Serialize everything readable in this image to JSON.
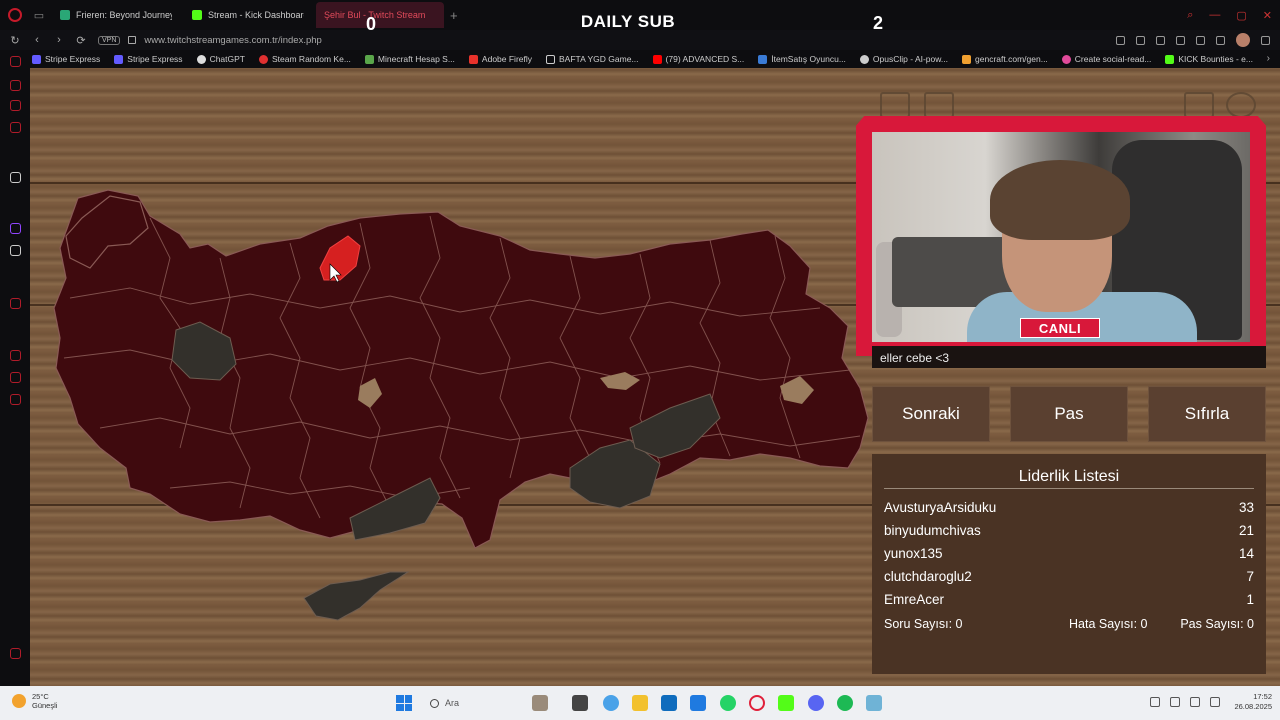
{
  "browser": {
    "tabs": [
      {
        "label": "Frieren: Beyond Journey's",
        "color": "#2aa776",
        "active": false
      },
      {
        "label": "Stream - Kick Dashboard",
        "color": "#53fc18",
        "active": false
      },
      {
        "label": "Şehir Bul - Twitch Stream",
        "color": "#c9405a",
        "active": true
      }
    ],
    "vpn": "VPN",
    "url": "www.twitchstreamgames.com.tr/index.php",
    "bookmarks": [
      {
        "label": "Stripe Express",
        "color": "#635bff"
      },
      {
        "label": "Stripe Express",
        "color": "#635bff"
      },
      {
        "label": "ChatGPT",
        "color": "#dddddd"
      },
      {
        "label": "Steam Random Ke...",
        "color": "#e03030"
      },
      {
        "label": "Minecraft Hesap S...",
        "color": "#5aa64a"
      },
      {
        "label": "Adobe Firefly",
        "color": "#e8322b"
      },
      {
        "label": "BAFTA YGD Game...",
        "color": "#cccccc"
      },
      {
        "label": "(79) ADVANCED S...",
        "color": "#ff0000"
      },
      {
        "label": "İtemSatış Oyuncu...",
        "color": "#3a7bd5"
      },
      {
        "label": "OpusClip - AI-pow...",
        "color": "#cccccc"
      },
      {
        "label": "gencraft.com/gen...",
        "color": "#f0a030"
      },
      {
        "label": "Create social-read...",
        "color": "#e04a9a"
      },
      {
        "label": "KICK Bounties - e...",
        "color": "#53fc18"
      }
    ]
  },
  "overlay": {
    "title": "DAILY SUB",
    "left_count": "0",
    "right_count": "2"
  },
  "game": {
    "chat_message": "eller cebe <3",
    "live_badge": "CANLI",
    "buttons": {
      "next": "Sonraki",
      "pass": "Pas",
      "reset": "Sıfırla"
    },
    "leaderboard": {
      "title": "Liderlik Listesi",
      "rows": [
        {
          "name": "AvusturyaArsiduku",
          "score": "33"
        },
        {
          "name": "binyudumchivas",
          "score": "21"
        },
        {
          "name": "yunox135",
          "score": "14"
        },
        {
          "name": "clutchdaroglu2",
          "score": "7"
        },
        {
          "name": "EmreAcer",
          "score": "1"
        }
      ]
    },
    "stats": {
      "questions": "Soru Sayısı: 0",
      "errors": "Hata Sayısı: 0",
      "passes": "Pas Sayısı: 0"
    },
    "colors": {
      "province": "#3f0a0e",
      "province_border": "#8a5a55",
      "highlighted": "#d62020",
      "grey_region": "#33302b"
    }
  },
  "taskbar": {
    "temperature": "25°C",
    "weather": "Güneşli",
    "search_placeholder": "Ara",
    "time": "17:52",
    "date": "26.08.2025"
  }
}
